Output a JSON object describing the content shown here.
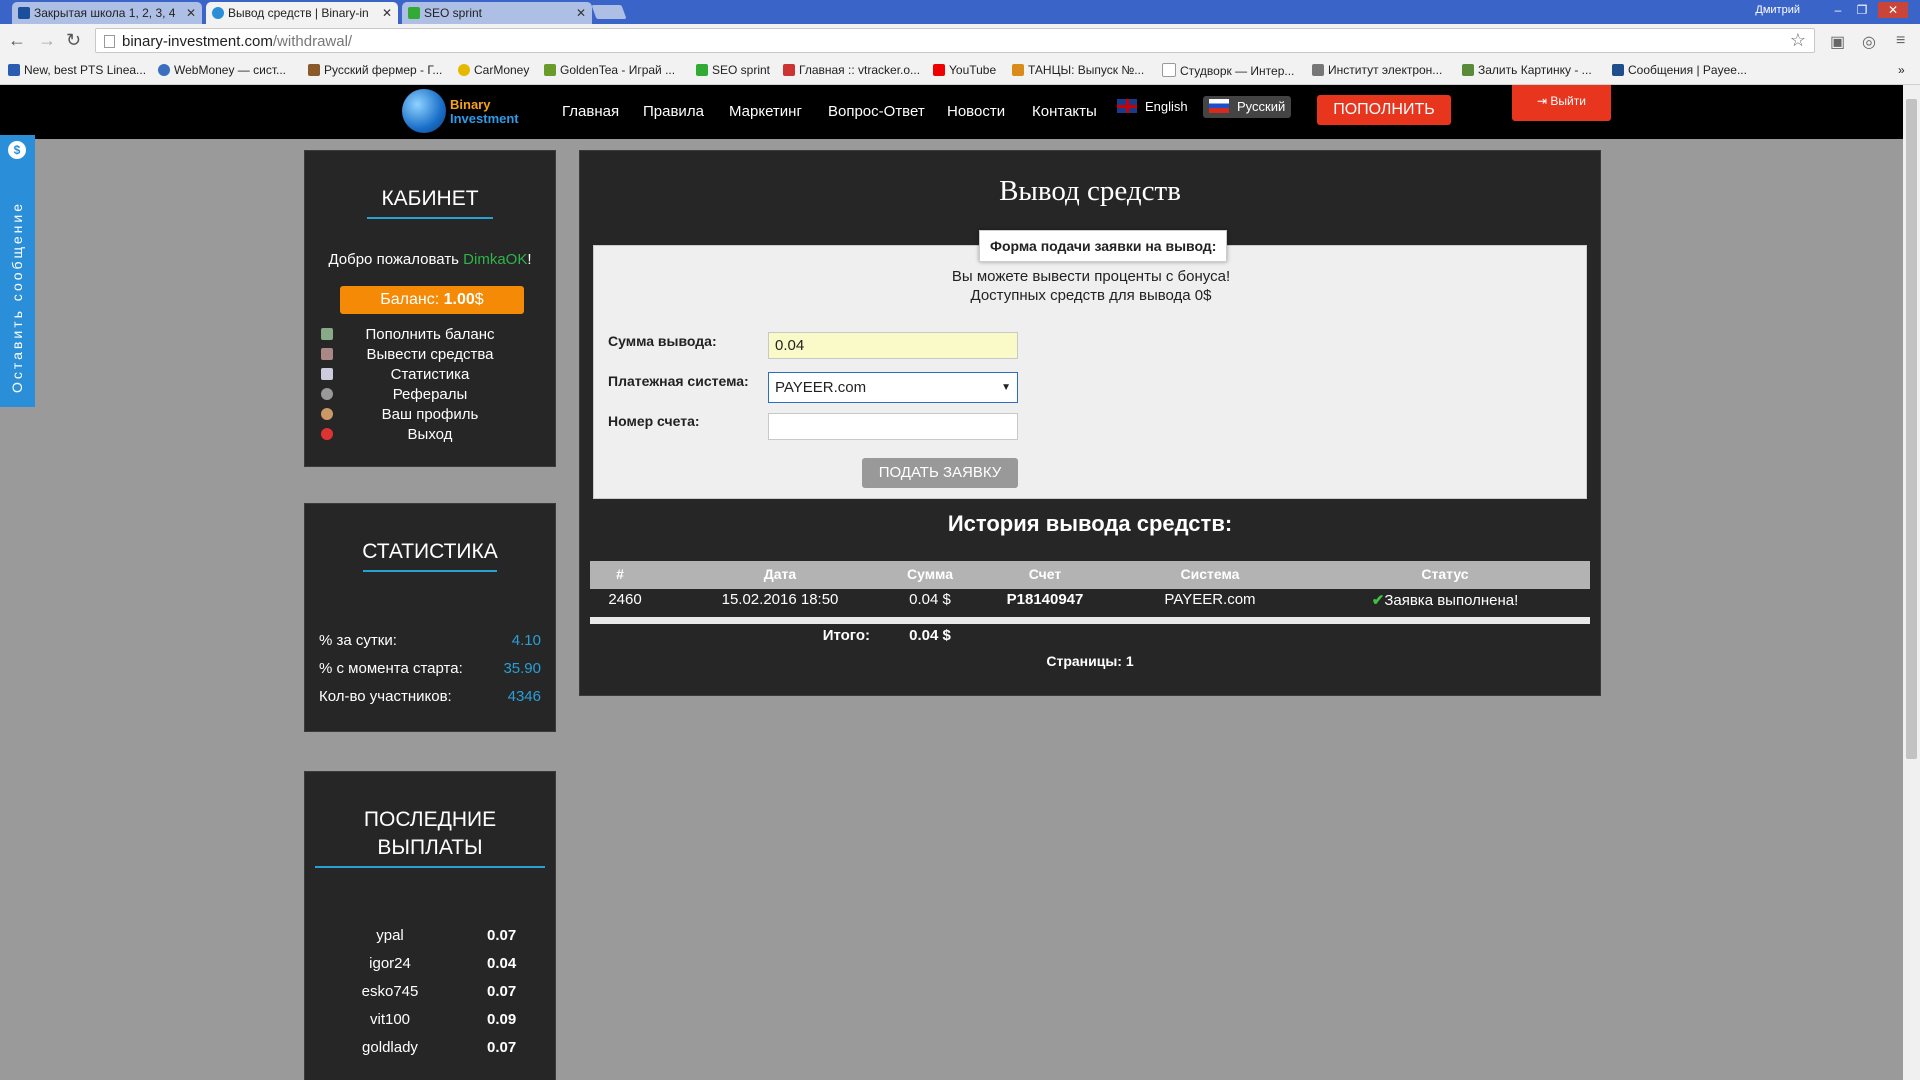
{
  "browser": {
    "tabs": [
      {
        "title": "Закрытая школа 1, 2, 3, 4"
      },
      {
        "title": "Вывод средств | Binary-in"
      },
      {
        "title": "SEO sprint"
      }
    ],
    "user": "Дмитрий",
    "url_host": "binary-investment.com",
    "url_path": "/withdrawal/",
    "bookmarks": [
      "New, best PTS Linea...",
      "WebMoney — сист...",
      "Русский фермер - Г...",
      "CarMoney",
      "GoldenTea - Играй ...",
      "SEO sprint",
      "Главная :: vtracker.o...",
      "YouTube",
      "ТАНЦЫ: Выпуск №...",
      "Студворк — Интер...",
      "Институт электрон...",
      "Залить Картинку - ...",
      "Сообщения | Payee..."
    ]
  },
  "feedback": {
    "label": "Оставить сообщение"
  },
  "header": {
    "logo_line1": "Binary",
    "logo_line2": "Investment",
    "nav": [
      "Главная",
      "Правила",
      "Маркетинг",
      "Вопрос-Ответ",
      "Новости",
      "Контакты"
    ],
    "lang_en": "English",
    "lang_ru": "Русский",
    "deposit_label": "ПОПОЛНИТЬ",
    "logout_label": "Выйти"
  },
  "cabinet": {
    "title": "КАБИНЕТ",
    "welcome": "Добро пожаловать",
    "username": "DimkaOK",
    "exclaim": "!",
    "balance_label": "Баланс:",
    "balance_value": "1.00",
    "balance_currency": "$",
    "menu": [
      "Пополнить баланс",
      "Вывести средства",
      "Статистика",
      "Рефералы",
      "Ваш профиль",
      "Выход"
    ]
  },
  "stats": {
    "title": "СТАТИСТИКА",
    "rows": [
      {
        "label": "% за сутки:",
        "value": "4.10"
      },
      {
        "label": "% с момента старта:",
        "value": "35.90"
      },
      {
        "label": "Кол-во участников:",
        "value": "4346"
      }
    ]
  },
  "payouts": {
    "title_line1": "ПОСЛЕДНИЕ",
    "title_line2": "ВЫПЛАТЫ",
    "rows": [
      {
        "name": "ypal",
        "value": "0.07"
      },
      {
        "name": "igor24",
        "value": "0.04"
      },
      {
        "name": "esko745",
        "value": "0.07"
      },
      {
        "name": "vit100",
        "value": "0.09"
      },
      {
        "name": "goldlady",
        "value": "0.07"
      }
    ]
  },
  "main": {
    "title": "Вывод средств",
    "form_legend": "Форма подачи заявки на вывод:",
    "info1": "Вы можете вывести проценты с бонуса!",
    "info2": "Доступных средств для вывода 0$",
    "amount_label": "Сумма вывода:",
    "amount_value": "0.04",
    "system_label": "Платежная система:",
    "system_value": "PAYEER.com",
    "account_label": "Номер счета:",
    "account_value": "",
    "submit_label": "ПОДАТЬ ЗАЯВКУ",
    "history_title": "История вывода средств:",
    "columns": [
      "#",
      "Дата",
      "Сумма",
      "Счет",
      "Система",
      "Статус"
    ],
    "rows": [
      {
        "id": "2460",
        "date": "15.02.2016 18:50",
        "amount": "0.04 $",
        "account": "P18140947",
        "system": "PAYEER.com",
        "status": "Заявка выполнена!"
      }
    ],
    "total_label": "Итого:",
    "total_value": "0.04 $",
    "pages": "Страницы: 1"
  }
}
